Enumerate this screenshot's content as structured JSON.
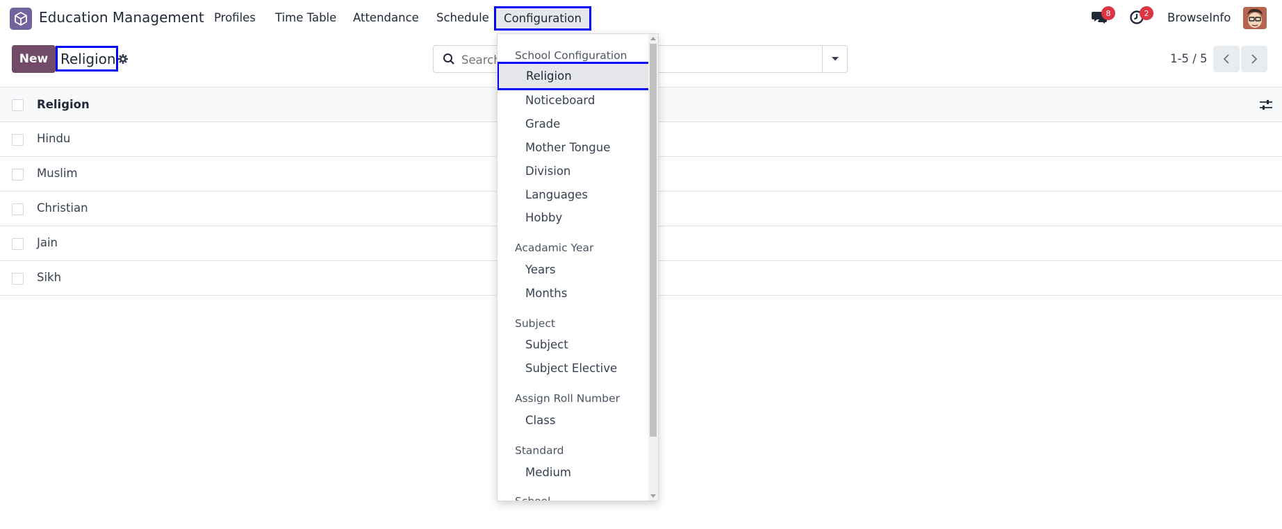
{
  "navbar": {
    "app_name": "Education Management",
    "menus": [
      "Profiles",
      "Time Table",
      "Attendance",
      "Schedule"
    ],
    "active_menu": "Configuration",
    "messages_count": "8",
    "activities_count": "2",
    "user_name": "BrowseInfo"
  },
  "control_panel": {
    "new_label": "New",
    "breadcrumb": "Religion",
    "search_placeholder": "Search...",
    "pager_value": "1-5 / 5"
  },
  "list": {
    "column_header": "Religion",
    "rows": [
      "Hindu",
      "Muslim",
      "Christian",
      "Jain",
      "Sikh"
    ]
  },
  "dropdown": {
    "sections": [
      {
        "header": "School Configuration",
        "items": [
          "Religion",
          "Noticeboard",
          "Grade",
          "Mother Tongue",
          "Division",
          "Languages",
          "Hobby"
        ]
      },
      {
        "header": "Acadamic Year",
        "items": [
          "Years",
          "Months"
        ]
      },
      {
        "header": "Subject",
        "items": [
          "Subject",
          "Subject Elective"
        ]
      },
      {
        "header": "Assign Roll Number",
        "items": [
          "Class"
        ]
      },
      {
        "header": "Standard",
        "items": [
          "Medium"
        ]
      },
      {
        "header": "School",
        "items": []
      }
    ],
    "active_item": "Religion"
  },
  "colors": {
    "brand": "#714b67",
    "highlight_border": "#0000ff",
    "badge": "#dc3545"
  },
  "icons": [
    "app-logo-icon",
    "chat-icon",
    "clock-icon",
    "gear-icon",
    "search-icon",
    "caret-down-icon",
    "chevron-left-icon",
    "chevron-right-icon",
    "sliders-icon"
  ]
}
